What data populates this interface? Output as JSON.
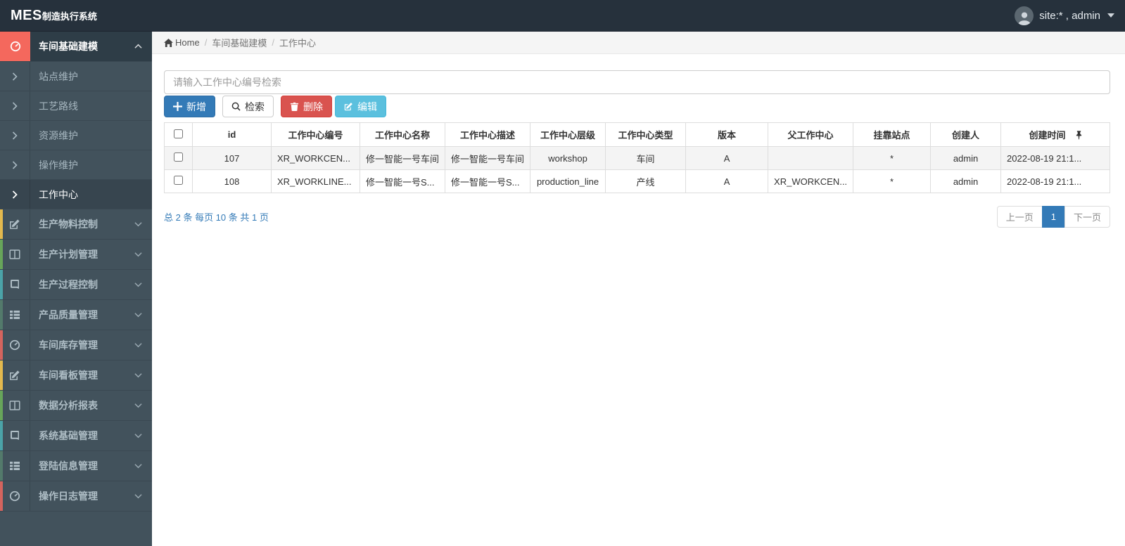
{
  "topbar": {
    "logo_bold": "MES",
    "logo_text": "制造执行系统",
    "user": "site:* , admin",
    "icons": {
      "avatar": "person-icon",
      "dropdown": "caret-down-icon"
    }
  },
  "sidebar": {
    "items": [
      {
        "label": "车间基础建模",
        "icon": "gauge-icon",
        "state": "expanded-active",
        "accent": "#f4685d"
      },
      {
        "label": "生产物料控制",
        "icon": "edit-icon",
        "accent": "#e3b94e"
      },
      {
        "label": "生产计划管理",
        "icon": "columns-icon",
        "accent": "#67a55a"
      },
      {
        "label": "生产过程控制",
        "icon": "book-icon",
        "accent": "#4ba3a8"
      },
      {
        "label": "产品质量管理",
        "icon": "list-icon",
        "accent": "#537a6b"
      },
      {
        "label": "车间库存管理",
        "icon": "gauge-icon",
        "accent": "#d4645e"
      },
      {
        "label": "车间看板管理",
        "icon": "edit-icon",
        "accent": "#e3b94e"
      },
      {
        "label": "数据分析报表",
        "icon": "columns-icon",
        "accent": "#67a55a"
      },
      {
        "label": "系统基础管理",
        "icon": "book-icon",
        "accent": "#4ba3a8"
      },
      {
        "label": "登陆信息管理",
        "icon": "list-icon",
        "accent": "#537a6b"
      },
      {
        "label": "操作日志管理",
        "icon": "gauge-icon",
        "accent": "#d4645e"
      }
    ],
    "submenu": [
      "站点维护",
      "工艺路线",
      "资源维护",
      "操作维护",
      "工作中心"
    ],
    "active_submenu": "工作中心"
  },
  "breadcrumb": {
    "home": "Home",
    "home_icon": "home-icon",
    "separator": "/",
    "items": [
      "车间基础建模",
      "工作中心"
    ]
  },
  "search": {
    "placeholder": "请输入工作中心编号检索"
  },
  "toolbar": {
    "add": "新增",
    "search": "检索",
    "delete": "删除",
    "edit": "编辑",
    "icons": [
      "plus-icon",
      "search-icon",
      "trash-icon",
      "edit-icon"
    ]
  },
  "table": {
    "columns": [
      "id",
      "工作中心编号",
      "工作中心名称",
      "工作中心描述",
      "工作中心层级",
      "工作中心类型",
      "版本",
      "父工作中心",
      "挂靠站点",
      "创建人",
      "创建时间"
    ],
    "last_column_icon": "pin-icon",
    "rows": [
      [
        "107",
        "XR_WORKCEN...",
        "修一智能一号车间",
        "修一智能一号车间",
        "workshop",
        "车间",
        "A",
        "",
        "*",
        "admin",
        "2022-08-19 21:1..."
      ],
      [
        "108",
        "XR_WORKLINE...",
        "修一智能一号S...",
        "修一智能一号S...",
        "production_line",
        "产线",
        "A",
        "XR_WORKCEN...",
        "*",
        "admin",
        "2022-08-19 21:1..."
      ]
    ]
  },
  "pagination": {
    "summary": "总 2 条 每页 10 条 共 1 页",
    "prev": "上一页",
    "current": "1",
    "next": "下一页"
  },
  "colors": {
    "topbar_bg": "#26313c",
    "sidebar_bg": "#42525c",
    "active_parent_bg": "#2e3d47",
    "active_icon_block": "#f4685d",
    "primary": "#337ab7",
    "danger": "#d9534f",
    "info": "#5bc0de",
    "link": "#337ab7",
    "table_border": "#dddddd",
    "stripe_row": "#f4f4f4"
  }
}
